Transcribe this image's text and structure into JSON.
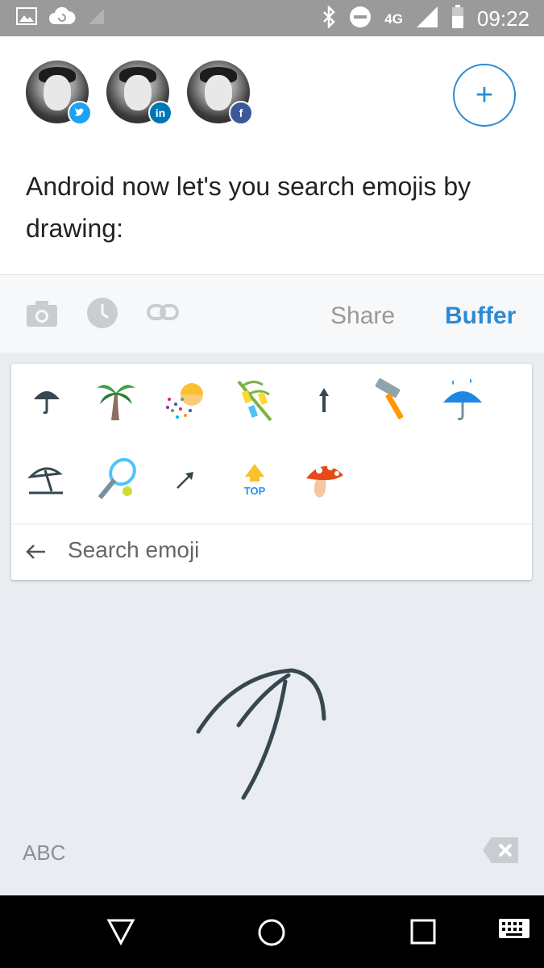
{
  "status_bar": {
    "time": "09:22",
    "network": "4G",
    "icons": [
      "image-icon",
      "cloud-sync-icon",
      "signal-weak-icon",
      "bluetooth-icon",
      "do-not-disturb-icon",
      "signal-icon",
      "battery-icon"
    ]
  },
  "accounts": [
    {
      "network": "twitter",
      "badge_color": "#1da1f2",
      "badge_icon": "twitter-icon"
    },
    {
      "network": "linkedin",
      "badge_label": "in",
      "badge_color": "#0077b5",
      "badge_icon": "linkedin-icon"
    },
    {
      "network": "facebook",
      "badge_label": "f",
      "badge_color": "#3b5998",
      "badge_icon": "facebook-icon"
    }
  ],
  "add_button": {
    "label": "+"
  },
  "post": {
    "text": "Android now let's you search emojis by drawing:"
  },
  "toolbar": {
    "icons": [
      "camera-icon",
      "clock-icon",
      "link-icon"
    ],
    "share_label": "Share",
    "buffer_label": "Buffer"
  },
  "emoji_results": [
    "umbrella",
    "palm-tree",
    "confetti-ball",
    "tanabata-tree",
    "up-arrow",
    "hammer",
    "umbrella-with-rain",
    "beach-umbrella",
    "tennis",
    "north-east-arrow",
    "top-arrow",
    "mushroom"
  ],
  "emoji_labels": {
    "top": "TOP"
  },
  "search": {
    "placeholder": "Search emoji"
  },
  "keyboard": {
    "abc_label": "ABC"
  },
  "nav": {
    "icons": [
      "back-icon",
      "home-icon",
      "recents-icon",
      "keyboard-icon"
    ]
  },
  "colors": {
    "accent": "#2b8bd3",
    "status_bar": "#9a9a9a",
    "keyboard_bg": "#e9edf1"
  }
}
